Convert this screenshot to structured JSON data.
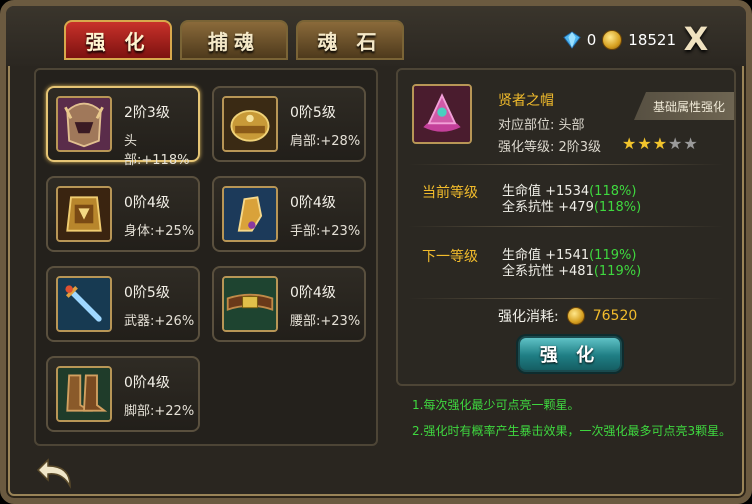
{
  "tabs": [
    {
      "label": "强 化",
      "active": true
    },
    {
      "label": "捕魂",
      "active": false
    },
    {
      "label": "魂 石",
      "active": false
    }
  ],
  "currency": {
    "gems": "0",
    "gold": "18521",
    "close": "X"
  },
  "colors": {
    "accent_gold": "#f2bc2c",
    "bonus_green": "#3fd83f",
    "selected_border": "#e6c575",
    "tab_red": "#c8312a",
    "button_teal": "#1f7e84"
  },
  "slots": [
    {
      "level": "2阶3级",
      "stat": "头部:+118%",
      "icon": "helmet-icon",
      "selected": true
    },
    {
      "level": "0阶5级",
      "stat": "肩部:+28%",
      "icon": "shoulder-armor-icon",
      "selected": false
    },
    {
      "level": "0阶4级",
      "stat": "身体:+25%",
      "icon": "body-armor-icon",
      "selected": false
    },
    {
      "level": "0阶4级",
      "stat": "手部:+23%",
      "icon": "gauntlet-icon",
      "selected": false
    },
    {
      "level": "0阶5级",
      "stat": "武器:+26%",
      "icon": "sword-icon",
      "selected": false
    },
    {
      "level": "0阶4级",
      "stat": "腰部:+23%",
      "icon": "belt-icon",
      "selected": false
    },
    {
      "level": "0阶4级",
      "stat": "脚部:+22%",
      "icon": "boots-icon",
      "selected": false
    }
  ],
  "detail": {
    "badge": "基础属性强化",
    "name": "贤者之帽",
    "part": "对应部位:   头部",
    "level": "强化等级:   2阶3级",
    "stars": {
      "filled": 3,
      "total": 5
    },
    "current": {
      "label": "当前等级",
      "lines": [
        {
          "text": "生命值 +1534",
          "pct": "(118%)"
        },
        {
          "text": "全系抗性 +479",
          "pct": "(118%)"
        }
      ]
    },
    "next": {
      "label": "下一等级",
      "lines": [
        {
          "text": "生命值 +1541",
          "pct": "(119%)"
        },
        {
          "text": "全系抗性 +481",
          "pct": "(119%)"
        }
      ]
    },
    "cost_label": "强化消耗:",
    "cost_value": "76520",
    "button": "强 化"
  },
  "tips": [
    "1.每次强化最少可点亮一颗星。",
    "2.强化时有概率产生暴击效果，一次强化最多可点亮3颗星。"
  ]
}
